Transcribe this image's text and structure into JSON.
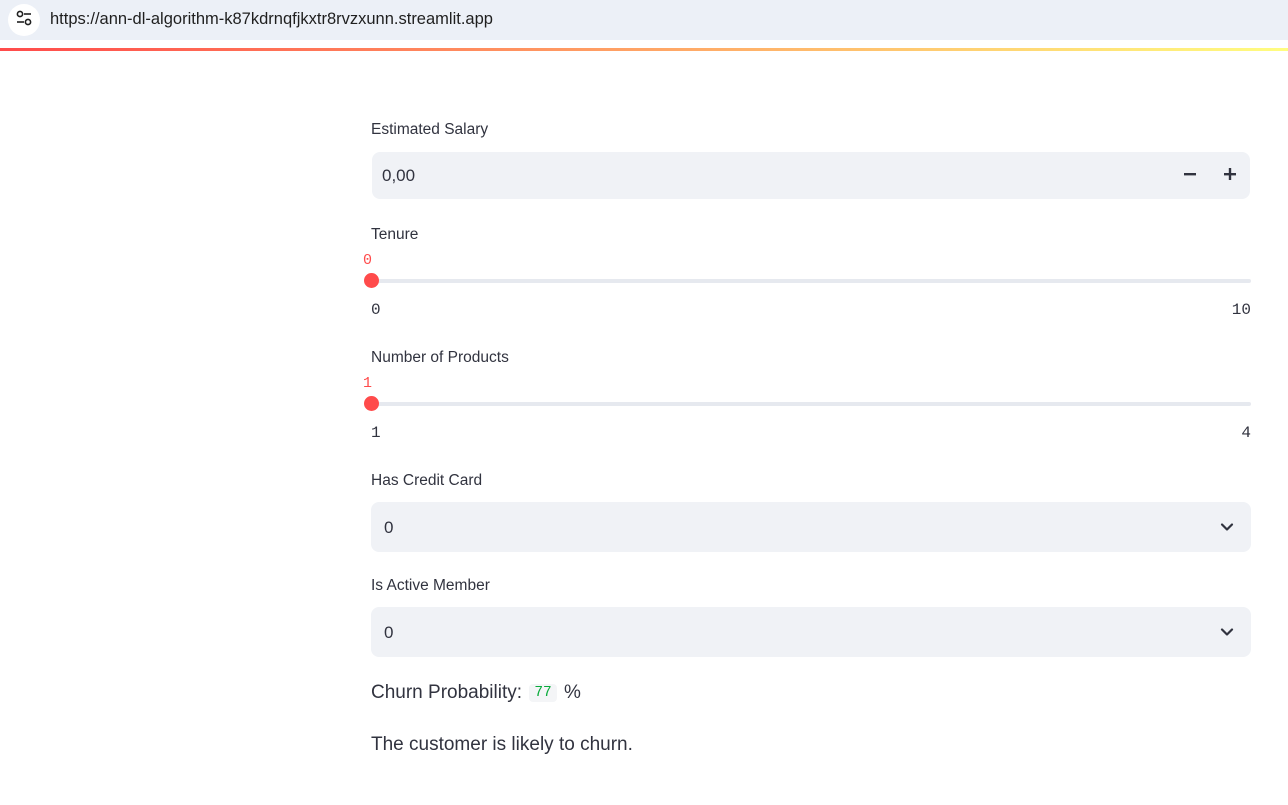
{
  "browser": {
    "url": "https://ann-dl-algorithm-k87kdrnqfjkxtr8rvzxunn.streamlit.app",
    "site_info_icon": "tune-icon"
  },
  "form": {
    "estimated_salary": {
      "label": "Estimated Salary",
      "value": "0,00",
      "decrement_icon": "minus-icon",
      "increment_icon": "plus-icon"
    },
    "tenure": {
      "label": "Tenure",
      "value": "0",
      "min_label": "0",
      "max_label": "10",
      "min": 0,
      "max": 10,
      "current": 0
    },
    "num_products": {
      "label": "Number of Products",
      "value": "1",
      "min_label": "1",
      "max_label": "4",
      "min": 1,
      "max": 4,
      "current": 1
    },
    "has_credit_card": {
      "label": "Has Credit Card",
      "selected": "0"
    },
    "is_active_member": {
      "label": "Is Active Member",
      "selected": "0"
    }
  },
  "result": {
    "probability_label": "Churn Probability:",
    "probability_value": "77",
    "probability_unit": "%",
    "verdict": "The customer is likely to churn."
  },
  "colors": {
    "primary": "#ff4b4b",
    "input_bg": "#f0f2f6",
    "text": "#31333f",
    "code_green": "#09ab3b"
  }
}
